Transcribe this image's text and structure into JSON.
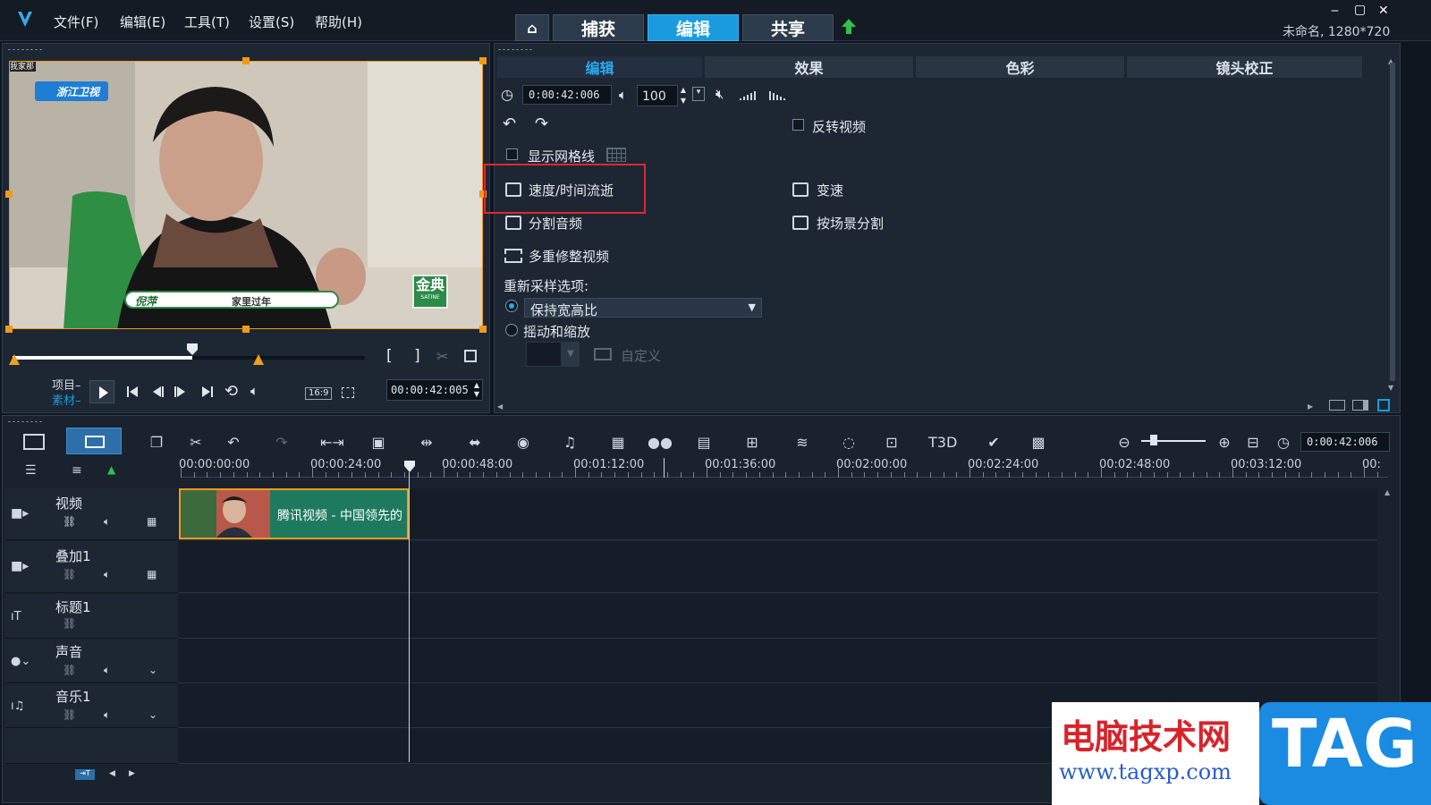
{
  "menu": [
    "文件(F)",
    "编辑(E)",
    "工具(T)",
    "设置(S)",
    "帮助(H)"
  ],
  "top_tabs": {
    "capture": "捕获",
    "edit": "编辑",
    "share": "共享"
  },
  "project_info": "未命名, 1280*720",
  "window_controls": {
    "minimize": "‒",
    "maximize": "▢",
    "close": "✕"
  },
  "preview": {
    "channel_logo": "浙江卫视",
    "caption_name": "倪萍",
    "caption_text": "家里过年",
    "show_logo": "金典",
    "show_logo_sub": "SATINE",
    "corner_tag": "我家那",
    "mode_project": "项目",
    "mode_clip": "素材",
    "aspect": "16:9",
    "timecode": "00:00:42:005",
    "playhead_fraction": 0.51
  },
  "options": {
    "tabs": [
      "编辑",
      "效果",
      "色彩",
      "镜头校正"
    ],
    "duration": "0:00:42:006",
    "volume": "100",
    "reverse_video": "反转视频",
    "show_grid": "显示网格线",
    "speed_timelapse": "速度/时间流逝",
    "variable_speed": "变速",
    "split_audio": "分割音频",
    "split_by_scene": "按场景分割",
    "multi_trim": "多重修整视频",
    "resample_label": "重新采样选项:",
    "keep_aspect": "保持宽高比",
    "pan_zoom": "摇动和缩放",
    "custom": "自定义"
  },
  "timeline": {
    "timecode": "0:00:42:006",
    "ruler_ticks": [
      "00:00:00:00",
      "00:00:24:00",
      "00:00:48:00",
      "00:01:12:00",
      "00:01:36:00",
      "00:02:00:00",
      "00:02:24:00",
      "00:02:48:00",
      "00:03:12:00",
      "00:"
    ],
    "tracks": [
      "视频",
      "叠加1",
      "标题1",
      "声音",
      "音乐1"
    ],
    "clip_label": "腾讯视频 - 中国领先的"
  },
  "watermark": {
    "title": "电脑技术网",
    "url": "www.tagxp.com",
    "tag": "TAG"
  },
  "colors": {
    "accent": "#1a9be0",
    "highlight_box": "#e0282e",
    "clip": "#1e7a5e",
    "selection": "#f09a1a"
  }
}
